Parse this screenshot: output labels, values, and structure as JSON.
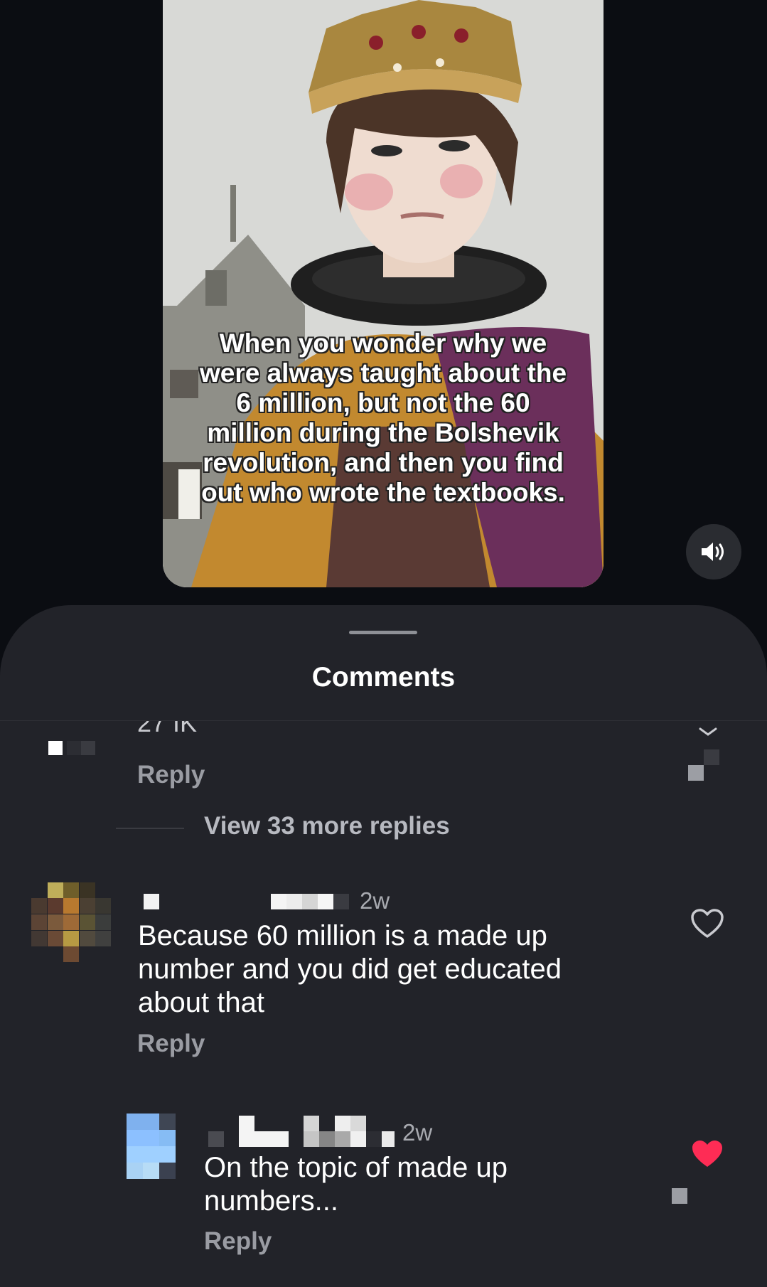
{
  "video": {
    "caption": "When you wonder why we were always taught about the 6 million, but not the 60 million during the Bolshevik revolution, and then you find out who wrote the textbooks."
  },
  "sheet": {
    "title": "Comments",
    "partial_like_count": "27 IK",
    "reply_label": "Reply",
    "view_more": "View 33 more replies"
  },
  "comments": [
    {
      "time": "2w",
      "text": "Because 60 million is a made up number and you did get educated about that",
      "reply": "Reply",
      "liked": false
    },
    {
      "time": "2w",
      "text": "On the topic of made up numbers...",
      "reply": "Reply",
      "liked": true
    }
  ],
  "colors": {
    "sheet_bg": "#222329",
    "liked_heart": "#fe2c55",
    "muted_text": "#9a9ca3"
  },
  "icons": {
    "sound": "speaker-icon",
    "like": "heart-icon",
    "expand": "chevron-down-icon"
  }
}
